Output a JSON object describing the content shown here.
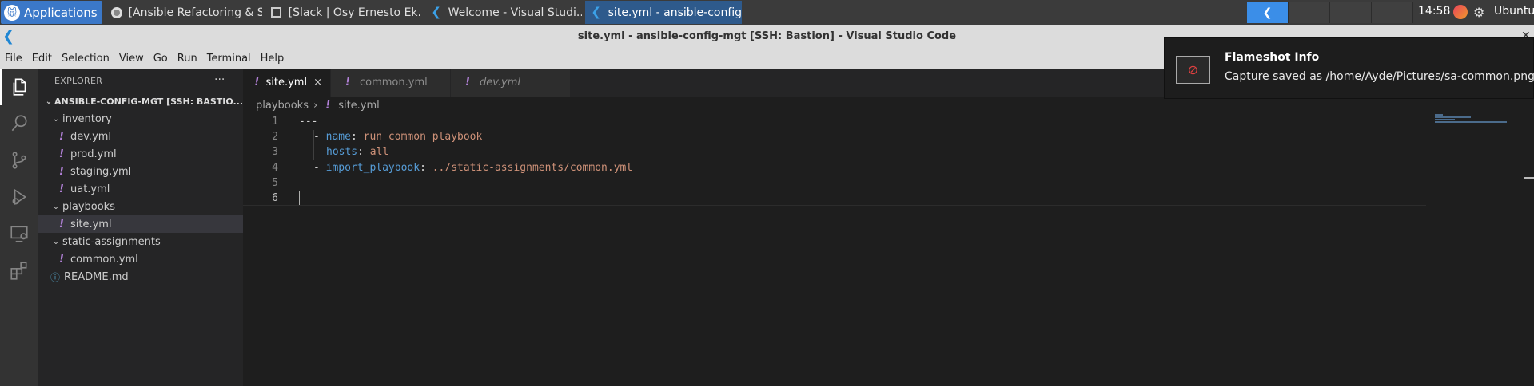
{
  "taskbar": {
    "apps_label": "Applications",
    "tasks": [
      {
        "label": "[Ansible Refactoring & S..."
      },
      {
        "label": "[Slack | Osy Ernesto Ek..."
      },
      {
        "label": "Welcome - Visual Studi..."
      },
      {
        "label": "site.yml - ansible-config..."
      }
    ],
    "clock": "14:58",
    "user": "Ubuntu"
  },
  "window": {
    "title": "site.yml - ansible-config-mgt [SSH: Bastion] - Visual Studio Code"
  },
  "menu": [
    "File",
    "Edit",
    "Selection",
    "View",
    "Go",
    "Run",
    "Terminal",
    "Help"
  ],
  "sidebar": {
    "header": "EXPLORER",
    "more": "···",
    "root": "ANSIBLE-CONFIG-MGT [SSH: BASTIO...",
    "tree": [
      {
        "type": "folder",
        "label": "inventory",
        "indent": 1
      },
      {
        "type": "file",
        "label": "dev.yml",
        "indent": 2
      },
      {
        "type": "file",
        "label": "prod.yml",
        "indent": 2
      },
      {
        "type": "file",
        "label": "staging.yml",
        "indent": 2
      },
      {
        "type": "file",
        "label": "uat.yml",
        "indent": 2
      },
      {
        "type": "folder",
        "label": "playbooks",
        "indent": 1
      },
      {
        "type": "file",
        "label": "site.yml",
        "indent": 2,
        "selected": true
      },
      {
        "type": "folder",
        "label": "static-assignments",
        "indent": 1
      },
      {
        "type": "file",
        "label": "common.yml",
        "indent": 2
      },
      {
        "type": "readme",
        "label": "README.md",
        "indent": 1
      }
    ]
  },
  "tabs": [
    {
      "label": "site.yml",
      "active": true,
      "close": "×"
    },
    {
      "label": "common.yml"
    },
    {
      "label": "dev.yml",
      "preview": true
    }
  ],
  "breadcrumb": {
    "folder": "playbooks",
    "file": "site.yml"
  },
  "code": {
    "line_numbers": [
      "1",
      "2",
      "3",
      "4",
      "5",
      "6"
    ],
    "l1": "---",
    "l2_dash": "- ",
    "l2_key": "name",
    "l2_colon": ": ",
    "l2_val": "run common playbook",
    "l3_key": "hosts",
    "l3_colon": ": ",
    "l3_val": "all",
    "l4_dash": "- ",
    "l4_key": "import_playbook",
    "l4_colon": ": ",
    "l4_val": "../static-assignments/common.yml"
  },
  "notification": {
    "title": "Flameshot Info",
    "body": "Capture saved as /home/Ayde/Pictures/sa-common.png"
  }
}
